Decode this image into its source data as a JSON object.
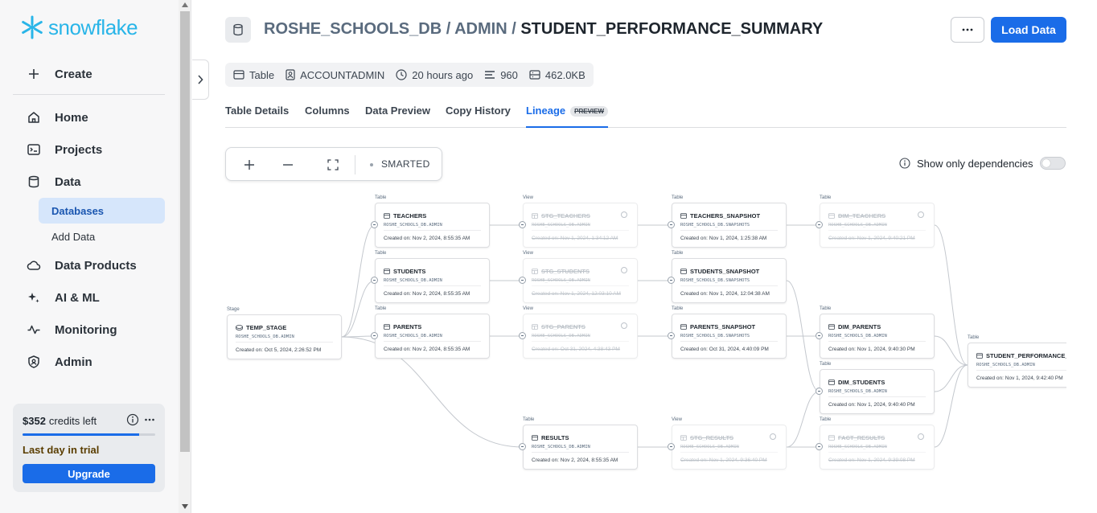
{
  "sidebar": {
    "logo_text": "snowflake",
    "create_label": "Create",
    "items": [
      {
        "label": "Home",
        "icon": "home-icon"
      },
      {
        "label": "Projects",
        "icon": "terminal-icon"
      },
      {
        "label": "Data",
        "icon": "database-icon"
      },
      {
        "label": "Data Products",
        "icon": "cloud-icon"
      },
      {
        "label": "AI & ML",
        "icon": "sparkle-icon"
      },
      {
        "label": "Monitoring",
        "icon": "pulse-icon"
      },
      {
        "label": "Admin",
        "icon": "shield-icon"
      }
    ],
    "data_subitems": [
      {
        "label": "Databases",
        "active": true
      },
      {
        "label": "Add Data",
        "active": false
      }
    ],
    "trial": {
      "credits_amount": "$352",
      "credits_suffix": "credits left",
      "progress_fraction": 0.88,
      "warning": "Last day in trial",
      "upgrade_label": "Upgrade"
    }
  },
  "header": {
    "breadcrumb_db": "ROSHE_SCHOOLS_DB",
    "breadcrumb_sep": " / ",
    "breadcrumb_schema": "ADMIN",
    "breadcrumb_table": "STUDENT_PERFORMANCE_SUMMARY",
    "load_button": "Load Data"
  },
  "meta": {
    "type": "Table",
    "owner": "ACCOUNTADMIN",
    "updated": "20 hours ago",
    "rows": "960",
    "size": "462.0KB"
  },
  "tabs": [
    {
      "label": "Table Details",
      "active": false
    },
    {
      "label": "Columns",
      "active": false
    },
    {
      "label": "Data Preview",
      "active": false
    },
    {
      "label": "Copy History",
      "active": false
    },
    {
      "label": "Lineage",
      "active": true,
      "badge": "PREVIEW"
    }
  ],
  "toolbar": {
    "label": "SMARTED"
  },
  "dependencies_toggle": {
    "label": "Show only dependencies",
    "on": false
  },
  "lineage": {
    "nodes": [
      {
        "id": "temp_stage",
        "type": "Stage",
        "name": "TEMP_STAGE",
        "schema": "ROSHE_SCHOOLS_DB.ADMIN",
        "created": "Created on: Oct 5, 2024, 2:26:52 PM",
        "dim": false,
        "icon": "stage-icon"
      },
      {
        "id": "teachers",
        "type": "Table",
        "name": "TEACHERS",
        "schema": "ROSHE_SCHOOLS_DB.ADMIN",
        "created": "Created on: Nov 2, 2024, 8:55:35 AM",
        "dim": false,
        "icon": "table-icon"
      },
      {
        "id": "students",
        "type": "Table",
        "name": "STUDENTS",
        "schema": "ROSHE_SCHOOLS_DB.ADMIN",
        "created": "Created on: Nov 2, 2024, 8:55:35 AM",
        "dim": false,
        "icon": "table-icon"
      },
      {
        "id": "parents",
        "type": "Table",
        "name": "PARENTS",
        "schema": "ROSHE_SCHOOLS_DB.ADMIN",
        "created": "Created on: Nov 2, 2024, 8:55:35 AM",
        "dim": false,
        "icon": "table-icon"
      },
      {
        "id": "stg_teachers",
        "type": "View",
        "name": "STG_TEACHERS",
        "schema": "ROSHE_SCHOOLS_DB.ADMIN",
        "created": "Created on: Nov 1, 2024, 1:34:12 AM",
        "dim": true,
        "icon": "view-icon"
      },
      {
        "id": "stg_students",
        "type": "View",
        "name": "STG_STUDENTS",
        "schema": "ROSHE_SCHOOLS_DB.ADMIN",
        "created": "Created on: Nov 1, 2024, 12:03:10 AM",
        "dim": true,
        "icon": "view-icon"
      },
      {
        "id": "stg_parents",
        "type": "View",
        "name": "STG_PARENTS",
        "schema": "ROSHE_SCHOOLS_DB.ADMIN",
        "created": "Created on: Oct 31, 2024, 4:38:43 PM",
        "dim": true,
        "icon": "view-icon"
      },
      {
        "id": "results",
        "type": "Table",
        "name": "RESULTS",
        "schema": "ROSHE_SCHOOLS_DB.ADMIN",
        "created": "Created on: Nov 2, 2024, 8:55:35 AM",
        "dim": false,
        "icon": "table-icon"
      },
      {
        "id": "teachers_snapshot",
        "type": "Table",
        "name": "TEACHERS_SNAPSHOT",
        "schema": "ROSHE_SCHOOLS_DB.SNAPSHOTS",
        "created": "Created on: Nov 1, 2024, 1:25:38 AM",
        "dim": false,
        "icon": "table-icon"
      },
      {
        "id": "students_snapshot",
        "type": "Table",
        "name": "STUDENTS_SNAPSHOT",
        "schema": "ROSHE_SCHOOLS_DB.SNAPSHOTS",
        "created": "Created on: Nov 1, 2024, 12:04:38 AM",
        "dim": false,
        "icon": "table-icon"
      },
      {
        "id": "parents_snapshot",
        "type": "Table",
        "name": "PARENTS_SNAPSHOT",
        "schema": "ROSHE_SCHOOLS_DB.SNAPSHOTS",
        "created": "Created on: Oct 31, 2024, 4:40:09 PM",
        "dim": false,
        "icon": "table-icon"
      },
      {
        "id": "stg_results",
        "type": "View",
        "name": "STG_RESULTS",
        "schema": "ROSHE_SCHOOLS_DB.ADMIN",
        "created": "Created on: Nov 1, 2024, 9:36:40 PM",
        "dim": true,
        "icon": "view-icon"
      },
      {
        "id": "dim_teachers",
        "type": "Table",
        "name": "DIM_TEACHERS",
        "schema": "ROSHE_SCHOOLS_DB.ADMIN",
        "created": "Created on: Nov 1, 2024, 9:40:21 PM",
        "dim": true,
        "icon": "table-icon"
      },
      {
        "id": "dim_parents",
        "type": "Table",
        "name": "DIM_PARENTS",
        "schema": "ROSHE_SCHOOLS_DB.ADMIN",
        "created": "Created on: Nov 1, 2024, 9:40:30 PM",
        "dim": false,
        "icon": "table-icon"
      },
      {
        "id": "dim_students",
        "type": "Table",
        "name": "DIM_STUDENTS",
        "schema": "ROSHE_SCHOOLS_DB.ADMIN",
        "created": "Created on: Nov 1, 2024, 9:40:40 PM",
        "dim": false,
        "icon": "table-icon"
      },
      {
        "id": "fact_results",
        "type": "Table",
        "name": "FACT_RESULTS",
        "schema": "ROSHE_SCHOOLS_DB.ADMIN",
        "created": "Created on: Nov 1, 2024, 9:39:08 PM",
        "dim": true,
        "icon": "table-icon"
      },
      {
        "id": "student_performance_summary",
        "type": "Table",
        "name": "STUDENT_PERFORMANCE_S...",
        "schema": "ROSHE_SCHOOLS_DB.ADMIN",
        "created": "Created on: Nov 1, 2024, 9:42:40 PM",
        "dim": false,
        "icon": "table-icon"
      }
    ],
    "edges": [
      [
        "temp_stage",
        "teachers"
      ],
      [
        "temp_stage",
        "students"
      ],
      [
        "temp_stage",
        "parents"
      ],
      [
        "temp_stage",
        "results"
      ],
      [
        "teachers",
        "stg_teachers"
      ],
      [
        "students",
        "stg_students"
      ],
      [
        "parents",
        "stg_parents"
      ],
      [
        "results",
        "stg_results"
      ],
      [
        "stg_teachers",
        "teachers_snapshot"
      ],
      [
        "stg_students",
        "students_snapshot"
      ],
      [
        "stg_parents",
        "parents_snapshot"
      ],
      [
        "teachers_snapshot",
        "dim_teachers"
      ],
      [
        "parents_snapshot",
        "dim_parents"
      ],
      [
        "students_snapshot",
        "dim_students"
      ],
      [
        "stg_results",
        "fact_results"
      ],
      [
        "stg_results",
        "dim_students"
      ],
      [
        "dim_teachers",
        "student_performance_summary"
      ],
      [
        "dim_parents",
        "student_performance_summary"
      ],
      [
        "dim_students",
        "student_performance_summary"
      ],
      [
        "fact_results",
        "student_performance_summary"
      ]
    ]
  },
  "colors": {
    "accent": "#1a6ce8",
    "brand": "#29b5e8",
    "active_nav_bg": "#d6e6fb"
  }
}
